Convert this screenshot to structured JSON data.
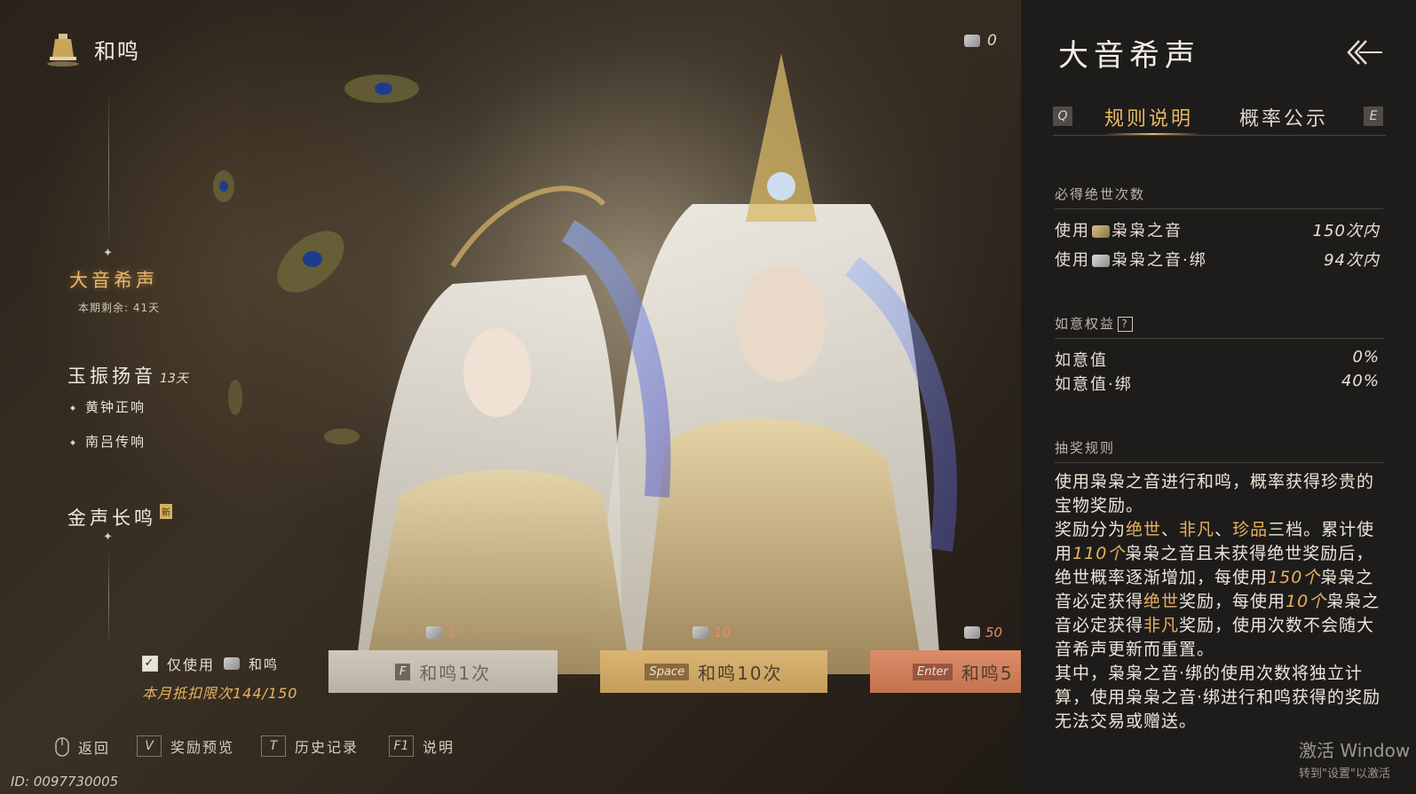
{
  "header": {
    "title": "和鸣",
    "currency_count": "0"
  },
  "nav": {
    "active": {
      "label": "大音希声",
      "remaining": "本期剩余: 41天"
    },
    "second": {
      "label": "玉振扬音",
      "days": "13天",
      "children": [
        "黄钟正响",
        "南吕传响"
      ]
    },
    "third": {
      "label": "金声长鸣",
      "badge": "新"
    }
  },
  "controls": {
    "only_use_label": "仅使用",
    "only_use_item": "和鸣",
    "only_use_checked": true,
    "monthly_limit": "本月抵扣限次144/150",
    "buttons": [
      {
        "key": "F",
        "label": "和鸣1次",
        "cost": "1"
      },
      {
        "key": "Space",
        "label": "和鸣10次",
        "cost": "10"
      },
      {
        "key": "Enter",
        "label": "和鸣5",
        "cost": "50"
      }
    ]
  },
  "footer": {
    "items": [
      {
        "key": "",
        "label": "返回",
        "icon": "mouse-icon"
      },
      {
        "key": "V",
        "label": "奖励预览"
      },
      {
        "key": "T",
        "label": "历史记录"
      },
      {
        "key": "F1",
        "label": "说明"
      }
    ],
    "id": "ID: 0097730005"
  },
  "panel": {
    "title": "大音希声",
    "tabs": [
      {
        "key": "Q",
        "label": "规则说明",
        "active": true
      },
      {
        "key": "E",
        "label": "概率公示",
        "active": false
      }
    ],
    "guarantee": {
      "heading": "必得绝世次数",
      "rows": [
        {
          "label_prefix": "使用",
          "item": "枭枭之音",
          "value": "150次内"
        },
        {
          "label_prefix": "使用",
          "item": "枭枭之音·绑",
          "value": "94次内"
        }
      ]
    },
    "ruyi": {
      "heading": "如意权益",
      "help": "?",
      "rows": [
        {
          "label": "如意值",
          "value": "0%"
        },
        {
          "label": "如意值·绑",
          "value": "40%"
        }
      ]
    },
    "rules": {
      "heading": "抽奖规则",
      "p1": "使用枭枭之音进行和鸣，概率获得珍贵的宝物奖励。",
      "p2_a": "奖励分为",
      "tier1": "绝世",
      "sep1": "、",
      "tier2": "非凡",
      "sep2": "、",
      "tier3": "珍品",
      "p2_b": "三档。累计使用",
      "n110": "110个",
      "p2_c": "枭枭之音且未获得绝世奖励后，绝世概率逐渐增加，每使用",
      "n150": "150个",
      "p2_d": "枭枭之音必定获得",
      "tier1b": "绝世",
      "p2_e": "奖励，每使用",
      "n10": "10个",
      "p2_f": "枭枭之音必定获得",
      "tier2b": "非凡",
      "p2_g": "奖励，使用次数不会随大音希声更新而重置。",
      "p3": "其中，枭枭之音·绑的使用次数将独立计算，使用枭枭之音·绑进行和鸣获得的奖励无法交易或赠送。"
    }
  },
  "watermark": {
    "line1": "激活 Window",
    "line2": "转到\"设置\"以激活"
  },
  "colors": {
    "accent_gold": "#e8b866",
    "panel_bg": "#1e1c1a",
    "btn10": "#d2ab69",
    "btn50": "#d38262"
  }
}
